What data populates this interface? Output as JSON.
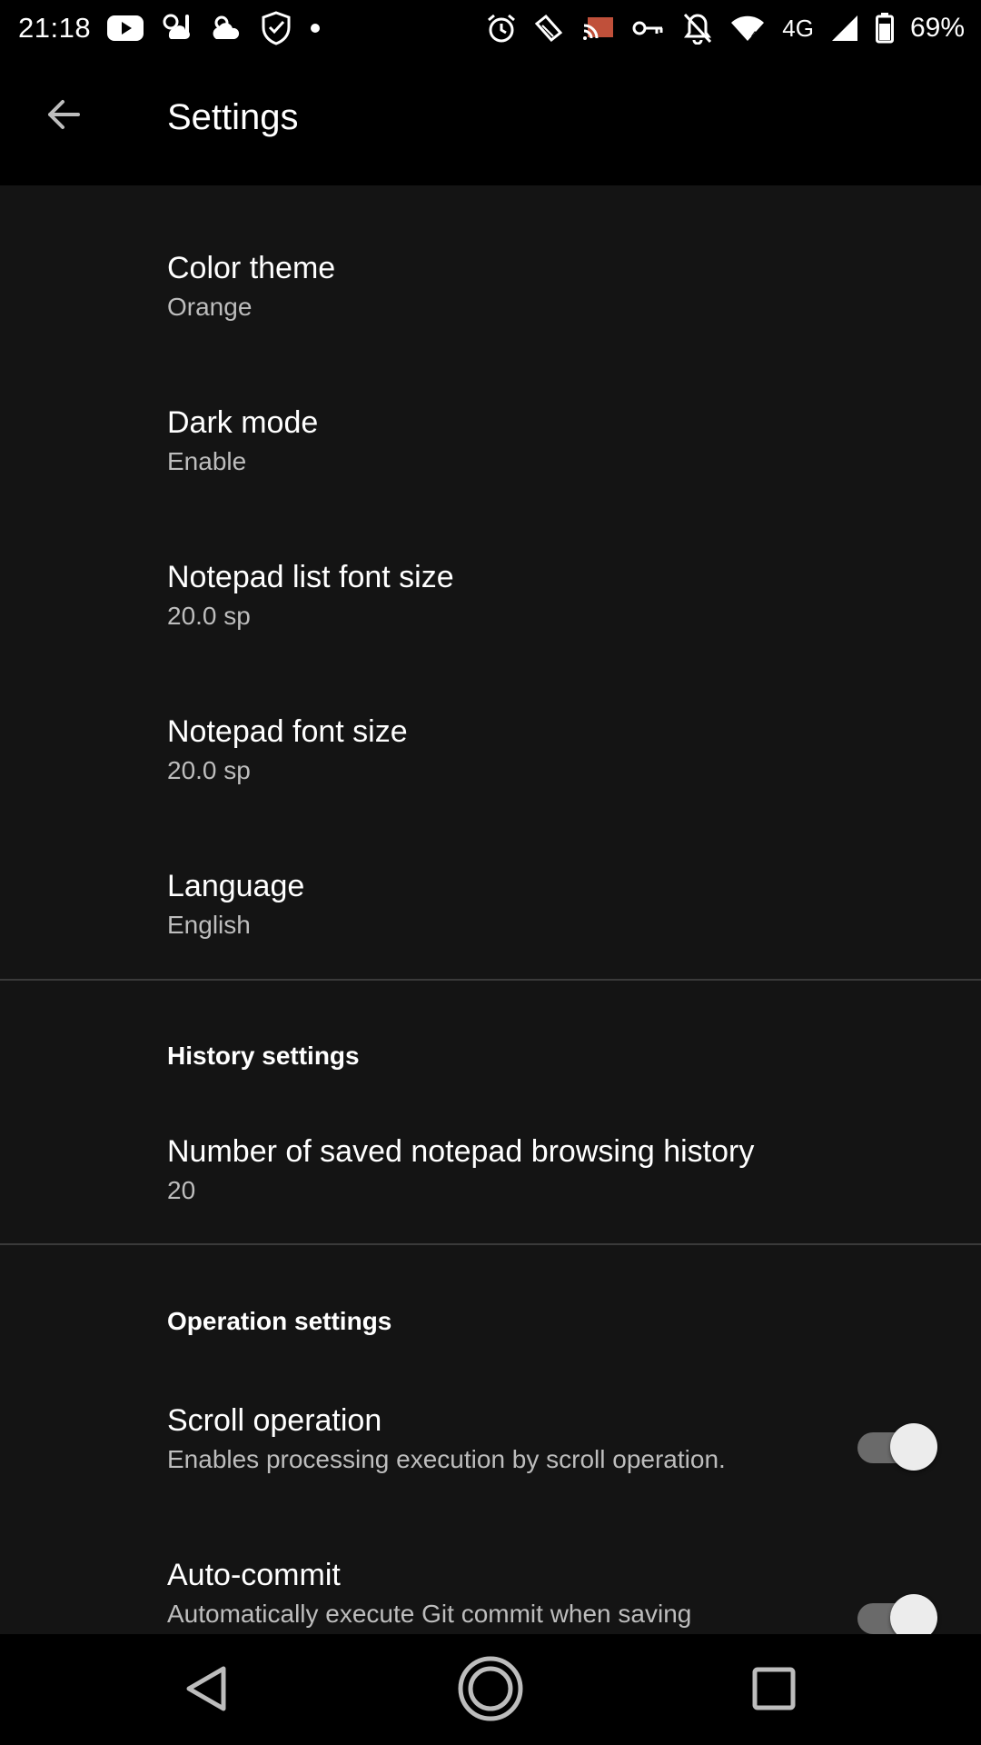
{
  "status_bar": {
    "time": "21:18",
    "network": "4G",
    "battery": "69%",
    "left_icons": [
      "youtube-icon",
      "weather-icon",
      "cloud-icon",
      "shield-check-icon",
      "dot-icon"
    ],
    "right_icons": [
      "alarm-icon",
      "nfc-icon",
      "cast-icon",
      "vpn-key-icon",
      "notifications-off-icon",
      "wifi-icon",
      "signal-icon",
      "battery-icon"
    ]
  },
  "app_bar": {
    "title": "Settings",
    "back_icon": "arrow-back-icon"
  },
  "preferences": {
    "color_theme": {
      "title": "Color theme",
      "summary": "Orange"
    },
    "dark_mode": {
      "title": "Dark mode",
      "summary": "Enable"
    },
    "list_font_size": {
      "title": "Notepad list font size",
      "summary": "20.0 sp"
    },
    "font_size": {
      "title": "Notepad font size",
      "summary": "20.0 sp"
    },
    "language": {
      "title": "Language",
      "summary": "English"
    }
  },
  "history": {
    "category": "History settings",
    "saved_history": {
      "title": "Number of saved notepad browsing history",
      "summary": "20"
    }
  },
  "operation": {
    "category": "Operation settings",
    "scroll_operation": {
      "title": "Scroll operation",
      "summary": "Enables processing execution by scroll operation.",
      "enabled": true
    },
    "auto_commit": {
      "title": "Auto-commit",
      "summary": "Automatically execute Git commit when saving",
      "enabled": true
    }
  },
  "nav_bar": {
    "buttons": [
      "nav-back-icon",
      "nav-home-icon",
      "nav-recents-icon"
    ]
  },
  "colors": {
    "background": "#141414",
    "bars": "#000000",
    "summary_text": "#bdbdbd",
    "switch_track": "#6a6a6a",
    "switch_thumb": "#ececec",
    "cast_accent": "#c0503a"
  }
}
